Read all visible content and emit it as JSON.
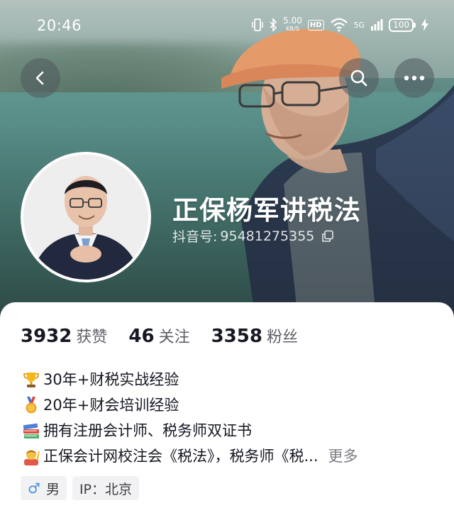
{
  "status_bar": {
    "time": "20:46",
    "net_speed": "5.00",
    "net_unit": "KB/S",
    "hd": "HD",
    "signal": "5G",
    "battery": "100"
  },
  "nav": {
    "back_icon": "back-arrow-icon",
    "search_icon": "search-icon",
    "more_icon": "more-dots-icon"
  },
  "profile": {
    "name": "正保杨军讲税法",
    "id_label": "抖音号:",
    "id_value": "95481275355"
  },
  "stats": [
    {
      "value": "3932",
      "label": "获赞"
    },
    {
      "value": "46",
      "label": "关注"
    },
    {
      "value": "3358",
      "label": "粉丝"
    }
  ],
  "bio": [
    {
      "icon": "trophy-icon",
      "text": "30年+财税实战经验"
    },
    {
      "icon": "medal-icon",
      "text": "20年+财会培训经验"
    },
    {
      "icon": "books-icon",
      "text": "拥有注册会计师、税务师双证书"
    },
    {
      "icon": "raising-hand-icon",
      "text": "正保会计网校注会《税法》，税务师《税...",
      "more": "更多"
    }
  ],
  "tags": {
    "gender_symbol": "♂",
    "gender": "男",
    "ip": "IP：北京"
  },
  "colors": {
    "card_bg": "#ffffff",
    "text": "#161823",
    "muted": "#5f6068",
    "tag_bg": "#f2f2f4"
  }
}
